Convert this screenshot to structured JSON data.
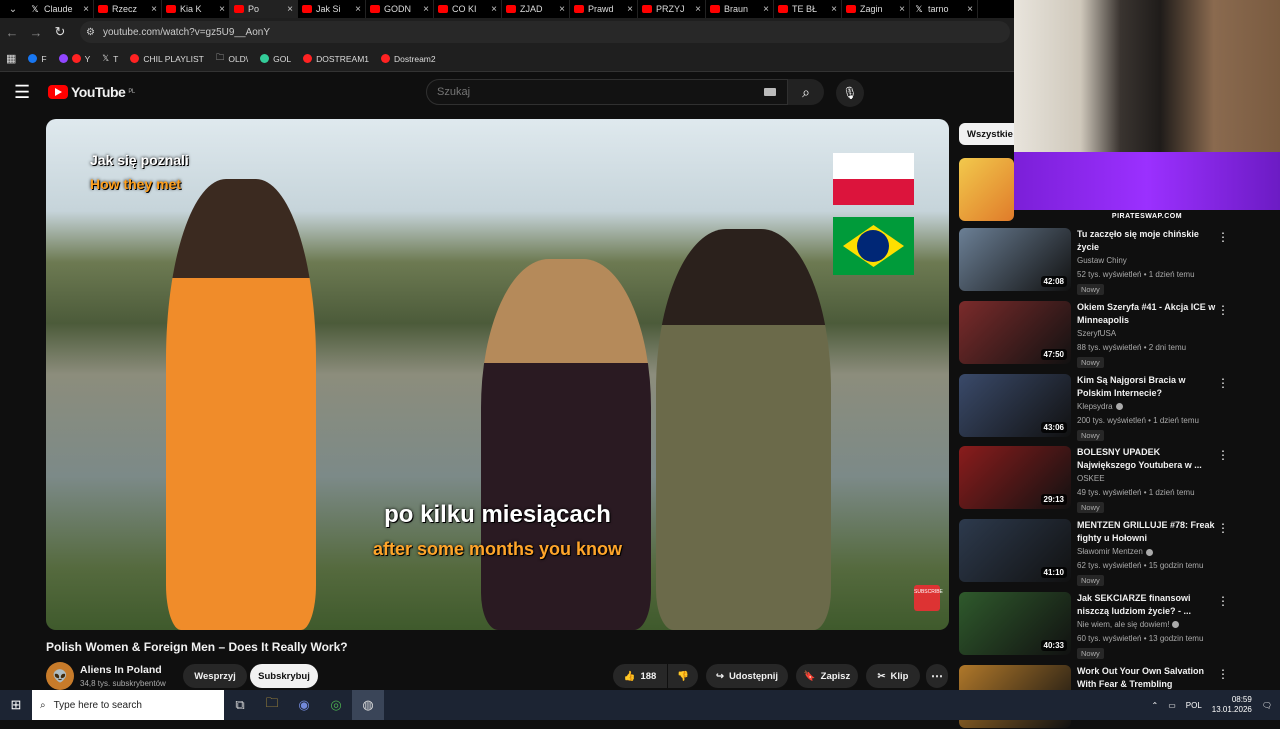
{
  "browser": {
    "tabs": [
      {
        "label": "Claude",
        "icon": "x"
      },
      {
        "label": "Rzecz",
        "icon": "yt"
      },
      {
        "label": "Kia K",
        "icon": "yt"
      },
      {
        "label": "Po",
        "icon": "yt",
        "active": true
      },
      {
        "label": "Jak Si",
        "icon": "yt"
      },
      {
        "label": "GODN",
        "icon": "yt"
      },
      {
        "label": "CO KI",
        "icon": "yt"
      },
      {
        "label": "ZJAD",
        "icon": "yt"
      },
      {
        "label": "Prawd",
        "icon": "yt"
      },
      {
        "label": "PRZYJ",
        "icon": "yt"
      },
      {
        "label": "Braun",
        "icon": "yt"
      },
      {
        "label": "TE BŁ",
        "icon": "yt"
      },
      {
        "label": "Zagin",
        "icon": "yt"
      },
      {
        "label": "tarno",
        "icon": "x"
      }
    ],
    "url": "youtube.com/watch?v=gz5U9__AonY",
    "bookmarks": [
      "F",
      "Y",
      "T",
      "CHIL PLAYLIST",
      "OLD\\",
      "GOL",
      "DOSTREAM1",
      "Dostream2"
    ]
  },
  "youtube": {
    "logo": "YouTube",
    "region": "PL",
    "search_placeholder": "Szukaj",
    "video": {
      "overlay_pl": "Jak się poznali",
      "overlay_en": "How they met",
      "subtitle_pl": "po kilku miesiącach",
      "subtitle_en": "after some months you know",
      "subscribe_badge": "SUBSCRIBE"
    },
    "title": "Polish Women & Foreign Men – Does It Really Work?",
    "channel": {
      "name": "Aliens In Poland",
      "subs": "34,8 tys. subskrybentów"
    },
    "actions": {
      "support": "Wesprzyj",
      "subscribe": "Subskrybuj",
      "likes": "188",
      "share": "Udostępnij",
      "save": "Zapisz",
      "clip": "Klip"
    },
    "chip": "Wszystkie",
    "recommendations": [
      {
        "title": "Tu zaczęło się moje chińskie życie",
        "channel": "Gustaw Chiny",
        "meta": "52 tys. wyświetleń • 1 dzień temu",
        "duration": "42:08",
        "new": "Nowy",
        "color": "#6b7f95"
      },
      {
        "title": "Okiem Szeryfa #41 - Akcja ICE w Minneapolis",
        "channel": "SzeryfUSA",
        "meta": "88 tys. wyświetleń • 2 dni temu",
        "duration": "47:50",
        "new": "Nowy",
        "color": "#7b2b2b"
      },
      {
        "title": "Kim Są Najgorsi Bracia w Polskim Internecie?",
        "channel": "Klepsydra",
        "meta": "200 tys. wyświetleń • 1 dzień temu",
        "duration": "43:06",
        "new": "Nowy",
        "verified": true,
        "color": "#3a4a6a"
      },
      {
        "title": "BOLESNY UPADEK Największego Youtubera w ...",
        "channel": "OSKEE",
        "meta": "49 tys. wyświetleń • 1 dzień temu",
        "duration": "29:13",
        "new": "Nowy",
        "color": "#8a1c1c"
      },
      {
        "title": "MENTZEN GRILLUJE #78: Freak fighty u Hołowni",
        "channel": "Sławomir Mentzen",
        "meta": "62 tys. wyświetleń • 15 godzin temu",
        "duration": "41:10",
        "new": "Nowy",
        "verified": true,
        "color": "#2d3a4d"
      },
      {
        "title": "Jak SEKCIARZE finansowi niszczą ludziom życie? - ...",
        "channel": "Nie wiem, ale się dowiem!",
        "meta": "60 tys. wyświetleń • 13 godzin temu",
        "duration": "40:33",
        "new": "Nowy",
        "verified": true,
        "color": "#2f5a2c"
      },
      {
        "title": "Work Out Your Own Salvation With Fear & Trembling",
        "channel": "",
        "meta": "",
        "duration": "",
        "new": "",
        "color": "#b0782a"
      }
    ]
  },
  "stream": {
    "sponsor": "PIRATESWAP.COM"
  },
  "taskbar": {
    "search_placeholder": "Type here to search",
    "lang": "POL",
    "time": "08:59",
    "date": "13.01.2026"
  }
}
